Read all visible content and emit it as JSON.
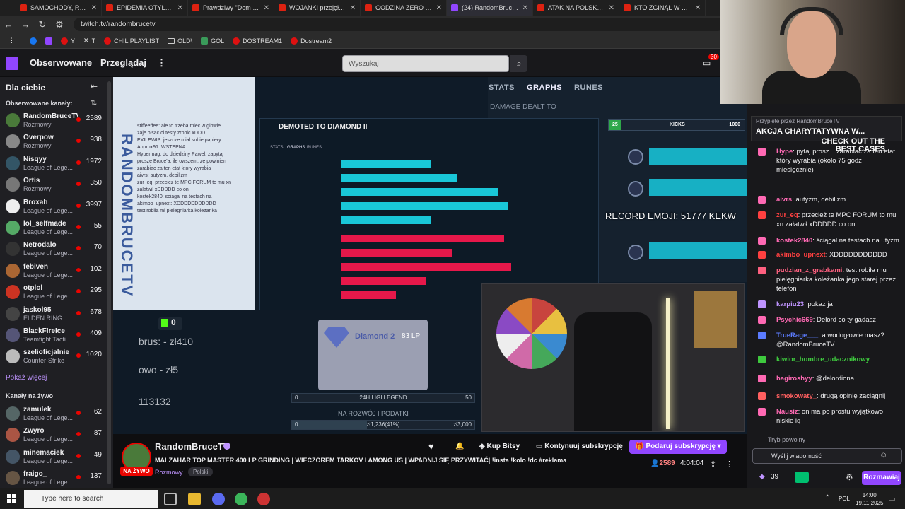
{
  "browser": {
    "tabs": [
      {
        "title": "SAMOCHODY, RESTA",
        "active": false
      },
      {
        "title": "EPIDEMIA OTYŁOŚCI",
        "active": false
      },
      {
        "title": "Prawdziwy \"Dom dob",
        "active": false
      },
      {
        "title": "WOJANKI przejęły un",
        "active": false
      },
      {
        "title": "GODZINA ZERO #147",
        "active": false
      },
      {
        "title": "(24) RandomBruceTV",
        "active": true
      },
      {
        "title": "ATAK NA POLSKĘ KO",
        "active": false
      },
      {
        "title": "KTO ZGINĄŁ W PIER",
        "active": false
      }
    ],
    "url": "twitch.tv/randombrucetv",
    "bookmarks": [
      "Y",
      "T",
      "CHIL PLAYLIST",
      "OLD\\",
      "GOL",
      "DOSTREAM1",
      "Dostream2"
    ]
  },
  "topnav": {
    "following": "Obserwowane",
    "browse": "Przeglądaj",
    "search_placeholder": "Wyszukaj",
    "notif_count": "30"
  },
  "sidebar": {
    "title": "Dla ciebie",
    "followed_header": "Obserwowane kanały:",
    "followed": [
      {
        "name": "RandomBruceTV",
        "category": "Rozmowy",
        "viewers": "2589",
        "color": "#4a7a3a"
      },
      {
        "name": "Overpow",
        "category": "Rozmowy",
        "viewers": "938",
        "color": "#888"
      },
      {
        "name": "Nisqyy",
        "category": "League of Lege...",
        "viewers": "1972",
        "color": "#356"
      },
      {
        "name": "Ortis",
        "category": "Rozmowy",
        "viewers": "350",
        "color": "#777"
      },
      {
        "name": "Broxah",
        "category": "League of Lege...",
        "viewers": "3997",
        "color": "#eee"
      },
      {
        "name": "lol_selfmade",
        "category": "League of Lege...",
        "viewers": "55",
        "color": "#5a6"
      },
      {
        "name": "Netrodalo",
        "category": "League of Lege...",
        "viewers": "70",
        "color": "#333"
      },
      {
        "name": "febiven",
        "category": "League of Lege...",
        "viewers": "102",
        "color": "#a63"
      },
      {
        "name": "otplol_",
        "category": "League of Lege...",
        "viewers": "295",
        "color": "#c32"
      },
      {
        "name": "jaskol95",
        "category": "ELDEN RING",
        "viewers": "678",
        "color": "#444"
      },
      {
        "name": "BlackFIreIce",
        "category": "Teamfight Tacti...",
        "viewers": "409",
        "color": "#557"
      },
      {
        "name": "szelioficjalnie",
        "category": "Counter-Strike",
        "viewers": "1020",
        "color": "#bbb"
      }
    ],
    "show_more": "Pokaż więcej",
    "live_header": "Kanały na żywo",
    "live": [
      {
        "name": "zamulek",
        "category": "League of Lege...",
        "viewers": "62",
        "color": "#566"
      },
      {
        "name": "Zwyro",
        "category": "League of Lege...",
        "viewers": "87",
        "color": "#a54"
      },
      {
        "name": "minemaciek",
        "category": "League of Lege...",
        "viewers": "49",
        "color": "#456"
      },
      {
        "name": "fraigo_",
        "category": "League of Lege...",
        "viewers": "137",
        "color": "#654"
      }
    ]
  },
  "stream": {
    "tabs": [
      "STATS",
      "GRAPHS",
      "RUNES"
    ],
    "damage_title": "DAMAGE DEALT TO",
    "panel_title": "DEMOTED TO DIAMOND II",
    "panel_tabs": [
      "STATS",
      "GRAPHS",
      "RUNES"
    ],
    "kicks_label": "KICKS",
    "kicks_left": "25",
    "kicks_right": "1000",
    "record_text": "RECORD EMOJI: 51777 KEKW",
    "k_count": "0",
    "donors": [
      "brus: - zł410",
      "owo - zł5",
      "113132"
    ],
    "rank": "Diamond 2",
    "lp": "83 LP",
    "league_bar": {
      "left": "0",
      "center": "24H LIGI LEGEND",
      "right": "50",
      "fill_fraction": 0.0
    },
    "support_label": "NA ROZWÓJ I PODATKI",
    "money_bar": {
      "left": "0",
      "center": "zł1,236(41%)",
      "right": "zł3,000",
      "fill_fraction": 0.41
    },
    "bars_blue": [
      0.53,
      0.68,
      0.92,
      0.98,
      0.53
    ],
    "bars_red": [
      0.96,
      0.65,
      1.0,
      0.5,
      0.32
    ],
    "chat_overlay": [
      "stiffeeffee: ale to trzeba miec w glowie",
      "zaje.pisac ci testy zrobic xDDD",
      "EXILEWIP: jeszcze mial sobie papiery",
      "Approx91: WSTEPNA",
      "Hypermag: do dziedziny Pawel, zapytaj",
      "prosze Bruce'a, ile owszem, ze powinien",
      "zarabiac za ten etat ktory wyrabia",
      "aivrs: autyzm, debilizm",
      "zur_eq: przeciez te MPC FORUM to mu xn",
      "zalatwil xDDDDD co on",
      "kostek2840: sciagal na testach na",
      "akimbo_upnext: XDDDDDDDDDDD",
      "test robila mi pielegniarka kolezanka"
    ]
  },
  "channel": {
    "name": "RandomBruceTV",
    "live_label": "NA ŻYWO",
    "title": "MALZAHAR TOP MASTER 400 LP GRINDING | WIECZOREM TARKOV I AMONG US | WPADNIJ SIĘ PRZYWITAĆ| !insta !kolo !dc #reklama",
    "category": "Rozmowy",
    "tag": "Polski",
    "bits_label": "Kup Bitsy",
    "continue_sub": "Kontynuuj subskrypcję",
    "gift_sub": "Podaruj subskrypcję",
    "viewers": "2589",
    "uptime": "4:04:04"
  },
  "chat": {
    "pinned_by": "Przypięte przez RandomBruceTV",
    "pinned_text": "AKCJA CHARYTATYWNA W...",
    "case_banner": "CHECK OUT THE BEST CASES",
    "messages": [
      {
        "user": "Hype",
        "text": "pytaj prosz... zarabiać za ten etat który wyrabia (około 75 godz miesięcznie)",
        "color": "#ff69b4"
      },
      {
        "user": "aivrs",
        "text": "autyzm, debilizm",
        "color": "#ff69b4"
      },
      {
        "user": "zur_eq",
        "text": "przecież te MPC FORUM to mu xn załatwił xDDDDD co on",
        "color": "#ff4040"
      },
      {
        "user": "kostek2840",
        "text": "ściągał na testach na utyzm",
        "color": "#ff69b4"
      },
      {
        "user": "akimbo_upnext",
        "text": "XDDDDDDDDDDD",
        "color": "#ff4040"
      },
      {
        "user": "pudzian_z_grabkami",
        "text": "test robiła mu pielęgniarka koleżanka jego starej przez telefon",
        "color": "#ff6080"
      },
      {
        "user": "karpiu23",
        "text": "pokaz ja",
        "color": "#bf94ff"
      },
      {
        "user": "Psychic669",
        "text": "Delord co ty gadasz",
        "color": "#ff69b4"
      },
      {
        "user": "TrueRage___",
        "text": "a wodogłowie masz? @RandomBruceTV",
        "color": "#5c7cff"
      },
      {
        "user": "kiwior_hombre_udacznikowy",
        "text": "",
        "color": "#3ec93e"
      },
      {
        "user": "hagiroshyy",
        "text": "@delordiona",
        "color": "#ff69b4"
      },
      {
        "user": "smokowaty_",
        "text": "drugą opinię zaciągnij",
        "color": "#ff6060"
      },
      {
        "user": "Nausiz",
        "text": "on ma po prostu wyjątkowo niskie iq",
        "color": "#ff69b4"
      }
    ],
    "slow_mode": "Tryb powolny",
    "input_placeholder": "Wyślij wiadomość",
    "points": "39",
    "chat_button": "Rozmawiaj"
  },
  "taskbar": {
    "search": "Type here to search",
    "lang": "POL",
    "time": "14:00",
    "date": "19.11.2025"
  }
}
